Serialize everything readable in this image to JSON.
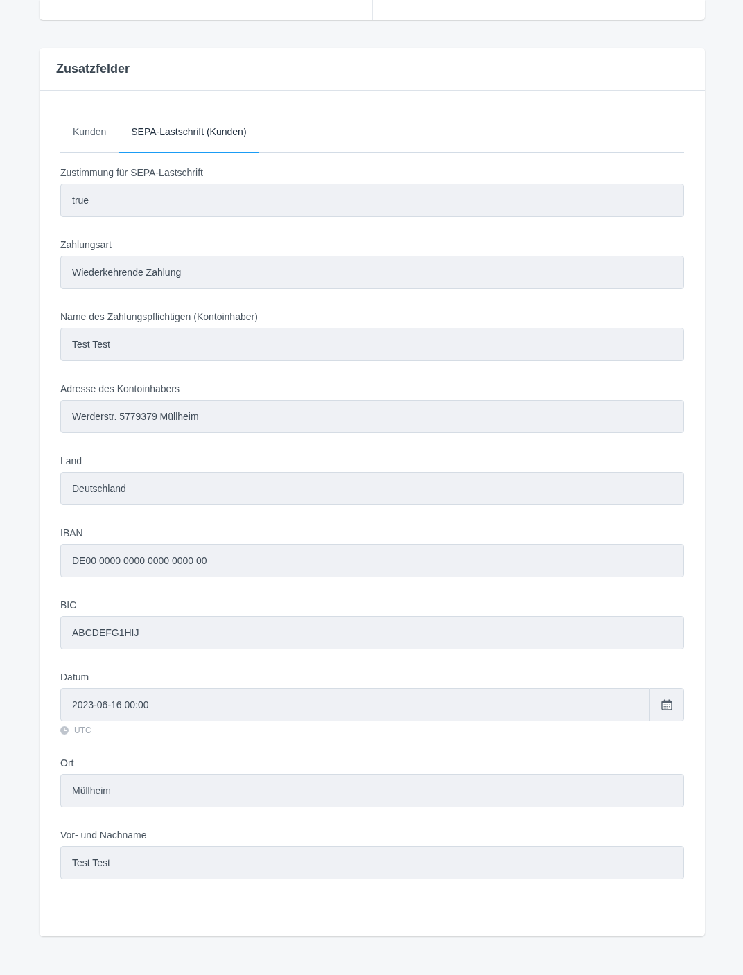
{
  "panel": {
    "title": "Zusatzfelder",
    "tabs": [
      {
        "label": "Kunden",
        "selected": false
      },
      {
        "label": "SEPA-Lastschrift (Kunden)",
        "selected": true
      }
    ],
    "fields": [
      {
        "kind": "text",
        "label": "Zustimmung für SEPA-Lastschrift",
        "value": "true",
        "disabled": true
      },
      {
        "kind": "text",
        "label": "Zahlungsart",
        "value": "Wiederkehrende Zahlung",
        "disabled": true
      },
      {
        "kind": "text",
        "label": "Name des Zahlungspflichtigen (Kontoinhaber)",
        "value": "Test Test",
        "disabled": true
      },
      {
        "kind": "text",
        "label": "Adresse des Kontoinhabers",
        "value": "Werderstr. 5779379 Müllheim",
        "disabled": true
      },
      {
        "kind": "text",
        "label": "Land",
        "value": "Deutschland",
        "disabled": true
      },
      {
        "kind": "text",
        "label": "IBAN",
        "value": "DE00 0000 0000 0000 0000 00",
        "disabled": true
      },
      {
        "kind": "text",
        "label": "BIC",
        "value": "ABCDEFG1HIJ",
        "disabled": true
      },
      {
        "kind": "datetime",
        "label": "Datum",
        "value": "2023-06-16 00:00",
        "hint": "UTC",
        "disabled": true
      },
      {
        "kind": "text",
        "label": "Ort",
        "value": "Müllheim",
        "disabled": true
      },
      {
        "kind": "text",
        "label": "Vor- und Nachname",
        "value": "Test Test",
        "disabled": true
      }
    ]
  }
}
